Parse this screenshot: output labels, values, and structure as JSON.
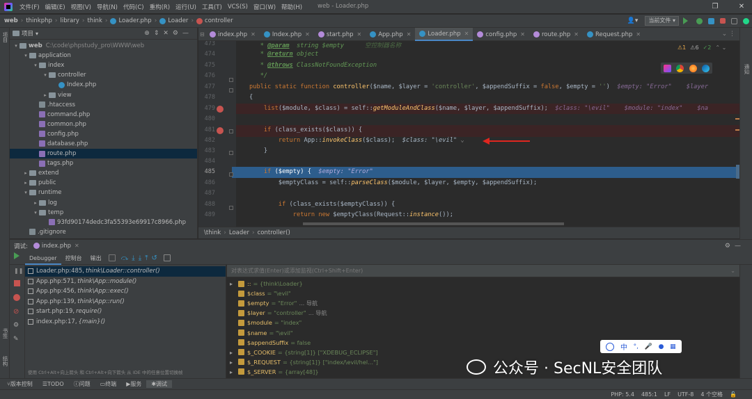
{
  "window": {
    "title": "web - Loader.php"
  },
  "menu": [
    "文件(F)",
    "编辑(E)",
    "视图(V)",
    "导航(N)",
    "代码(C)",
    "重构(R)",
    "运行(U)",
    "工具(T)",
    "VCS(S)",
    "窗口(W)",
    "帮助(H)"
  ],
  "breadcrumbs": [
    "web",
    "thinkphp",
    "library",
    "think",
    "Loader.php",
    "Loader",
    "controller"
  ],
  "toolbar": {
    "run_config": "当前文件"
  },
  "project": {
    "title": "项目",
    "root": "web",
    "root_path": "C:\\code\\phpstudy_pro\\WWW\\web",
    "tree": [
      {
        "label": "application",
        "indent": 1,
        "arrow": "▾",
        "type": "folder"
      },
      {
        "label": "index",
        "indent": 2,
        "arrow": "▾",
        "type": "folder"
      },
      {
        "label": "controller",
        "indent": 3,
        "arrow": "▾",
        "type": "folder"
      },
      {
        "label": "Index.php",
        "indent": 4,
        "arrow": "",
        "type": "class"
      },
      {
        "label": "view",
        "indent": 3,
        "arrow": "▸",
        "type": "folder"
      },
      {
        "label": ".htaccess",
        "indent": 2,
        "arrow": "",
        "type": "file"
      },
      {
        "label": "command.php",
        "indent": 2,
        "arrow": "",
        "type": "php"
      },
      {
        "label": "common.php",
        "indent": 2,
        "arrow": "",
        "type": "php"
      },
      {
        "label": "config.php",
        "indent": 2,
        "arrow": "",
        "type": "php"
      },
      {
        "label": "database.php",
        "indent": 2,
        "arrow": "",
        "type": "php"
      },
      {
        "label": "route.php",
        "indent": 2,
        "arrow": "",
        "type": "php",
        "selected": true
      },
      {
        "label": "tags.php",
        "indent": 2,
        "arrow": "",
        "type": "php"
      },
      {
        "label": "extend",
        "indent": 1,
        "arrow": "▸",
        "type": "folder"
      },
      {
        "label": "public",
        "indent": 1,
        "arrow": "▸",
        "type": "folder"
      },
      {
        "label": "runtime",
        "indent": 1,
        "arrow": "▾",
        "type": "folder"
      },
      {
        "label": "log",
        "indent": 2,
        "arrow": "▸",
        "type": "folder"
      },
      {
        "label": "temp",
        "indent": 2,
        "arrow": "▾",
        "type": "folder"
      },
      {
        "label": "93fd90174dedc3fa55393e69917c8966.php",
        "indent": 3,
        "arrow": "",
        "type": "php"
      },
      {
        "label": ".gitignore",
        "indent": 1,
        "arrow": "",
        "type": "file"
      }
    ]
  },
  "tabs": [
    "index.php",
    "Index.php",
    "start.php",
    "App.php",
    "Loader.php",
    "config.php",
    "route.php",
    "Request.php"
  ],
  "active_tab": "Loader.php",
  "inspections": {
    "warnings": "1",
    "weak": "6",
    "typos": "2"
  },
  "code": {
    "line_numbers": [
      "473",
      "474",
      "475",
      "476",
      "477",
      "478",
      "479",
      "480",
      "481",
      "482",
      "483",
      "484",
      "485",
      "486",
      "487",
      "488",
      "489"
    ],
    "current_line": "485",
    "l473_tag": "@param",
    "l473_rest": "  string $empty",
    "l473_note": "空控制器名称",
    "l474_tag": "@return",
    "l474_rest": " object",
    "l475_tag": "@throws",
    "l475_rest": " ClassNotFoundException",
    "l476": "*/",
    "l477_a": "public static function ",
    "l477_fn": "controller",
    "l477_b": "($name, $layer = ",
    "l477_s1": "'controller'",
    "l477_c": ", $appendSuffix = ",
    "l477_kw": "false",
    "l477_d": ", $empty = ",
    "l477_s2": "''",
    "l477_e": ")",
    "l477_inline": "  $empty: \"Error\"    $layer",
    "l478": "{",
    "l479_a": "list",
    "l479_b": "($module, $class) = self::",
    "l479_fn": "getModuleAndClass",
    "l479_c": "($name, $layer, $appendSuffix);",
    "l479_inline": "  $class: \"\\evil\"    $module: \"index\"    $na",
    "l481_a": "if",
    "l481_b": " (class_exists($class)) {",
    "l482_a": "return",
    "l482_b": " App::",
    "l482_fn": "invokeClass",
    "l482_c": "($class);",
    "l482_inline": "  $class: \"\\evil\"",
    "l483": "}",
    "l485_a": "if",
    "l485_b": " ($empty) {",
    "l485_inline": "  $empty: \"Error\"",
    "l486_a": "$emptyClass = self::",
    "l486_fn": "parseClass",
    "l486_b": "($module, $layer, $empty, $appendSuffix);",
    "l488_a": "if",
    "l488_b": " (class_exists($emptyClass)) {",
    "l489_a": "return new",
    "l489_b": " $emptyClass(Request::",
    "l489_fn": "instance",
    "l489_c": "());"
  },
  "editor_crumbs": [
    "\\think",
    "Loader",
    "controller()"
  ],
  "debug": {
    "label": "调试:",
    "session": "index.php",
    "tabs": [
      "Debugger",
      "控制台",
      "输出"
    ],
    "eval_placeholder": "对表达式求值(Enter)或添加监视(Ctrl+Shift+Enter)",
    "frames": [
      {
        "loc": "Loader.php:485,",
        "fn": "think\\Loader::controller()"
      },
      {
        "loc": "App.php:571,",
        "fn": "think\\App::module()"
      },
      {
        "loc": "App.php:456,",
        "fn": "think\\App::exec()"
      },
      {
        "loc": "App.php:139,",
        "fn": "think\\App::run()"
      },
      {
        "loc": "start.php:19,",
        "fn": "require()"
      },
      {
        "loc": "index.php:17,",
        "fn": "{main}()"
      }
    ],
    "hint": "使用 Ctrl+Alt+向上箭头 和 Ctrl+Alt+向下箭头 从 IDE 中的任意位置切换帧",
    "vars": [
      {
        "arrow": "▸",
        "name": "::",
        "value": "= {think\\Loader}",
        "extra": ""
      },
      {
        "arrow": "",
        "name": "$class",
        "value": "= \"\\evil\"",
        "extra": ""
      },
      {
        "arrow": "",
        "name": "$empty",
        "value": "= \"Error\"",
        "extra": "... 导航"
      },
      {
        "arrow": "",
        "name": "$layer",
        "value": "= \"controller\"",
        "extra": "... 导航"
      },
      {
        "arrow": "",
        "name": "$module",
        "value": "= \"index\"",
        "extra": ""
      },
      {
        "arrow": "",
        "name": "$name",
        "value": "= \"\\evil\"",
        "extra": ""
      },
      {
        "arrow": "",
        "name": "$appendSuffix",
        "value": "= false",
        "extra": ""
      },
      {
        "arrow": "▸",
        "name": "$_COOKIE",
        "value": "= {string[1]} [\"XDEBUG_ECLIPSE\"]",
        "extra": ""
      },
      {
        "arrow": "▸",
        "name": "$_REQUEST",
        "value": "= {string[1]} [\"index/\\evil/hel...\"]",
        "extra": ""
      },
      {
        "arrow": "▸",
        "name": "$_SERVER",
        "value": "= {array[48]}",
        "extra": ""
      }
    ]
  },
  "bottom_tools": [
    "版本控制",
    "TODO",
    "问题",
    "终端",
    "服务",
    "调试"
  ],
  "status": [
    "PHP: 5.4",
    "485:1",
    "LF",
    "UTF-8",
    "4 个空格"
  ],
  "left_strip": [
    "项目",
    "书签",
    "结构"
  ],
  "right_strip": [
    "通知"
  ],
  "watermark": "公众号 · SecNL安全团队",
  "ime": [
    "中",
    "°,"
  ],
  "colors": {
    "accent": "#4a88c7",
    "breakpoint": "#c75450",
    "selection": "#2d5d8c"
  }
}
